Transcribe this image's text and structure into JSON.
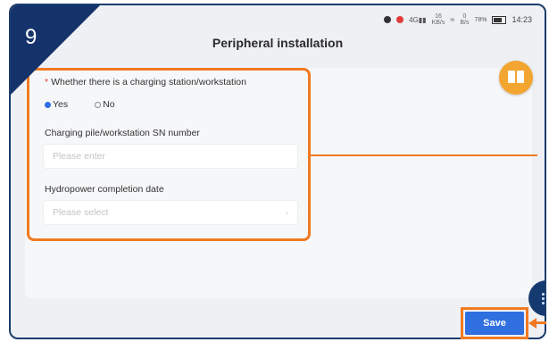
{
  "step_number": "9",
  "status_bar": {
    "network": "4G",
    "speed_value": "16",
    "speed_unit": "KB/s",
    "wifi_value": "0",
    "wifi_unit": "B/s",
    "battery": "78%",
    "time": "14:23"
  },
  "page": {
    "title": "Peripheral installation"
  },
  "form": {
    "question": {
      "required_mark": "*",
      "label": "Whether there is a charging station/workstation",
      "options": [
        {
          "label": "Yes",
          "selected": true
        },
        {
          "label": "No",
          "selected": false
        }
      ]
    },
    "sn_field": {
      "label": "Charging pile/workstation SN number",
      "placeholder": "Please enter",
      "value": ""
    },
    "date_field": {
      "label": "Hydropower completion date",
      "placeholder": "Please select",
      "value": ""
    }
  },
  "actions": {
    "save_label": "Save"
  },
  "colors": {
    "highlight": "#f07a22",
    "accent": "#2f6fe0",
    "corner_banner": "#15336b",
    "book_button": "#f3a531"
  },
  "icons": [
    "book-icon",
    "menu-dots-icon",
    "arrow-left-icon",
    "wifi-icon",
    "signal-icon",
    "battery-icon"
  ]
}
